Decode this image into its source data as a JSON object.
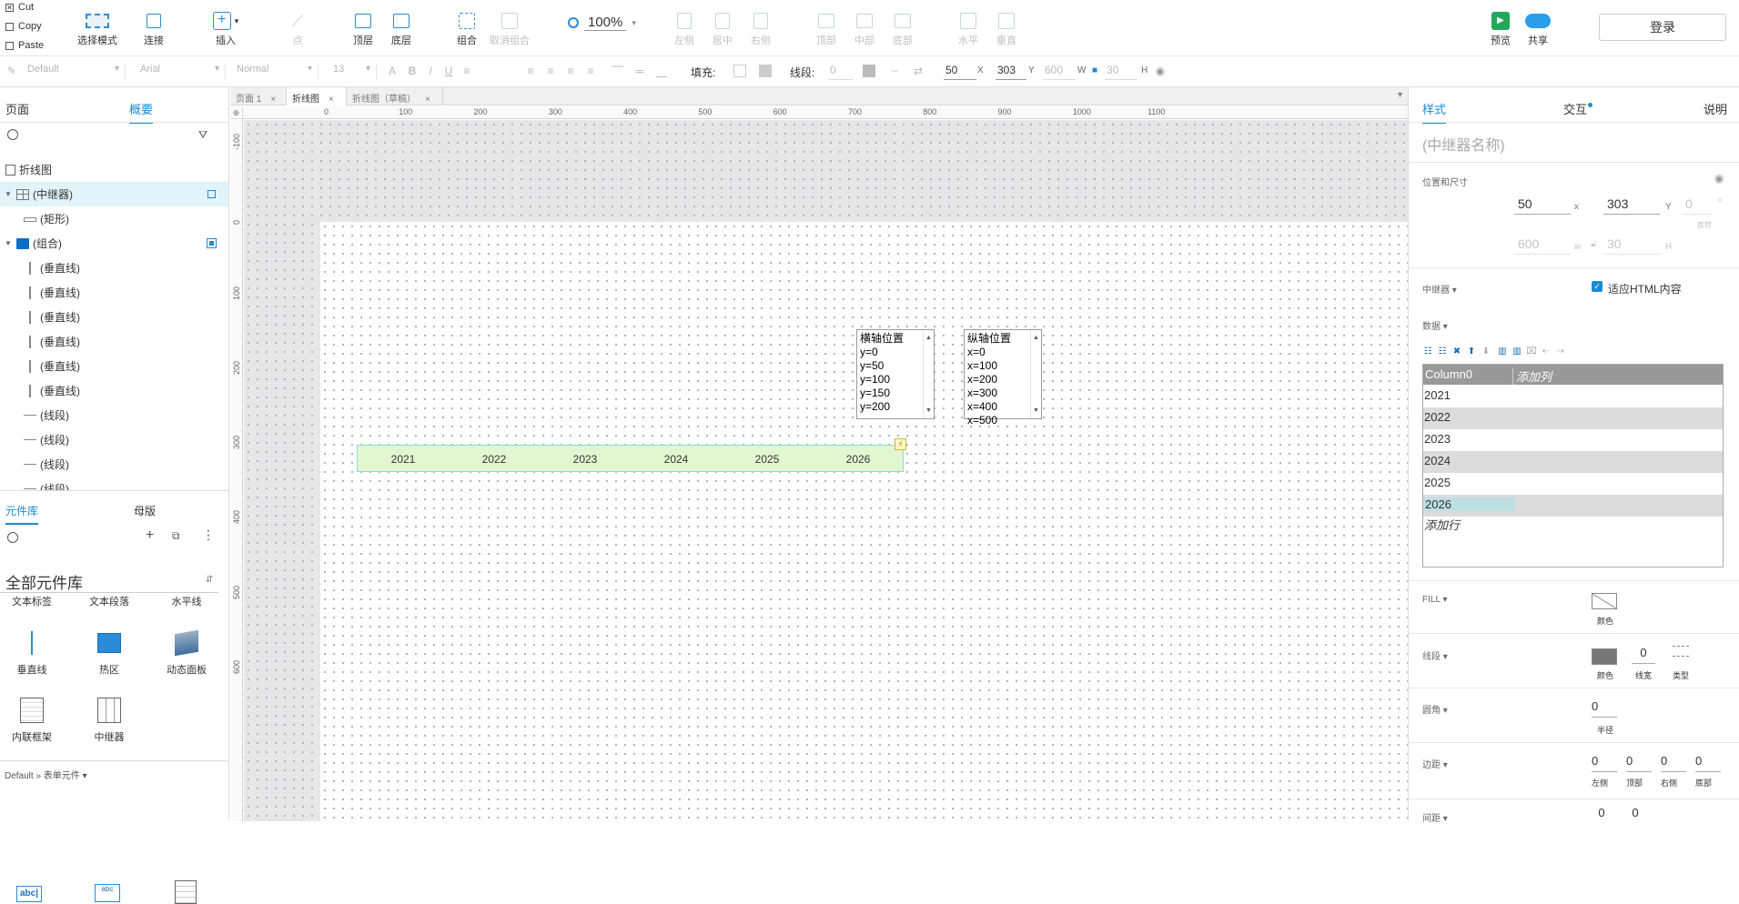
{
  "clipboard": {
    "cut": "Cut",
    "copy": "Copy",
    "paste": "Paste"
  },
  "toolbar": {
    "select_mode": "选择模式",
    "connect": "连接",
    "insert": "插入",
    "point": "点",
    "top_layer": "顶层",
    "bottom_layer": "底层",
    "group": "组合",
    "ungroup": "取消组合",
    "zoom": "100%",
    "align_left": "左侧",
    "align_center": "居中",
    "align_right": "右侧",
    "align_top": "顶部",
    "align_middle": "中部",
    "align_bottom": "底部",
    "dist_horizontal": "水平",
    "dist_vertical": "垂直",
    "preview": "预览",
    "share": "共享",
    "login": "登录"
  },
  "format_bar": {
    "style": "Default",
    "font": "Arial",
    "weight": "Normal",
    "size": "13",
    "fill_label": "填充:",
    "stroke_label": "线段:",
    "stroke_width": "0",
    "x": "50",
    "x_label": "X",
    "y": "303",
    "y_label": "Y",
    "w": "600",
    "w_label": "W",
    "h": "30",
    "h_label": "H"
  },
  "left_panel": {
    "tabs": [
      "页面",
      "概要"
    ],
    "active_tab": 1,
    "outline_title": "折线图",
    "outline": [
      {
        "label": "(中继器)",
        "type": "repeater",
        "indent": 0,
        "selected": true,
        "toggle": "▼"
      },
      {
        "label": "(矩形)",
        "type": "rect",
        "indent": 1
      },
      {
        "label": "(组合)",
        "type": "folder",
        "indent": 0,
        "toggle": "▼"
      },
      {
        "label": "(垂直线)",
        "type": "vline",
        "indent": 1
      },
      {
        "label": "(垂直线)",
        "type": "vline",
        "indent": 1
      },
      {
        "label": "(垂直线)",
        "type": "vline",
        "indent": 1
      },
      {
        "label": "(垂直线)",
        "type": "vline",
        "indent": 1
      },
      {
        "label": "(垂直线)",
        "type": "vline",
        "indent": 1
      },
      {
        "label": "(垂直线)",
        "type": "vline",
        "indent": 1
      },
      {
        "label": "(线段)",
        "type": "hline",
        "indent": 1
      },
      {
        "label": "(线段)",
        "type": "hline",
        "indent": 1
      },
      {
        "label": "(线段)",
        "type": "hline",
        "indent": 1
      },
      {
        "label": "(线段)",
        "type": "hline",
        "indent": 1
      }
    ],
    "lib_tabs": [
      "元件库",
      "母版"
    ],
    "lib_title": "全部元件库",
    "lib_items_top": [
      "文本标签",
      "文本段落",
      "水平线"
    ],
    "lib_items": [
      "垂直线",
      "热区",
      "动态面板",
      "内联框架",
      "中继器"
    ],
    "lib_footer": "Default » 表单元件 ▾",
    "lib_bottom_glyphs": [
      "abc|",
      "abc",
      ""
    ]
  },
  "canvas": {
    "tabs": [
      {
        "label": "页面 1"
      },
      {
        "label": "折线图",
        "active": true
      },
      {
        "label": "折线图（草稿）"
      }
    ],
    "h_ruler": [
      "0",
      "100",
      "200",
      "300",
      "400",
      "500",
      "600",
      "700",
      "800",
      "900",
      "1000",
      "1100"
    ],
    "v_ruler": [
      "-100",
      "0",
      "100",
      "200",
      "300",
      "400",
      "500",
      "600"
    ],
    "y_axis_box": {
      "title": "横轴位置",
      "items": [
        "y=0",
        "y=50",
        "y=100",
        "y=150",
        "y=200"
      ]
    },
    "x_axis_box": {
      "title": "纵轴位置",
      "items": [
        "x=0",
        "x=100",
        "x=200",
        "x=300",
        "x=400",
        "x=500"
      ]
    },
    "repeater_items": [
      "2021",
      "2022",
      "2023",
      "2024",
      "2025",
      "2026"
    ]
  },
  "right_panel": {
    "tabs": [
      "样式",
      "交互",
      "说明"
    ],
    "active_tab": 0,
    "name_placeholder": "(中继器名称)",
    "pos_size_label": "位置和尺寸",
    "x": "50",
    "x_label": "x",
    "y": "303",
    "y_label": "Y",
    "rot": "0",
    "rot_label": "旋转",
    "rot_unit": "°",
    "w": "600",
    "w_label": "w",
    "h": "30",
    "h_label": "H",
    "repeater_label": "中继器 ▾",
    "fit_html_label": "适应HTML内容",
    "data_label": "数据 ▾",
    "data_columns": [
      "Column0",
      "添加列"
    ],
    "data_rows": [
      "2021",
      "2022",
      "2023",
      "2024",
      "2025",
      "2026"
    ],
    "add_row": "添加行",
    "fill_label": "FILL ▾",
    "fill_color_label": "颜色",
    "stroke_label": "线段 ▾",
    "stroke_color_label": "颜色",
    "stroke_width": "0",
    "stroke_width_label": "线宽",
    "stroke_type_label": "类型",
    "corner_label": "圆角 ▾",
    "corner_value": "0",
    "corner_radius_label": "半径",
    "padding_label": "边距 ▾",
    "padding_values": [
      "0",
      "0",
      "0",
      "0"
    ],
    "padding_labels": [
      "左侧",
      "顶部",
      "右侧",
      "底部"
    ],
    "spacing_label": "间距 ▾",
    "spacing_values": [
      "0",
      "0"
    ]
  },
  "colors": {
    "accent": "#1b8ad3",
    "repeater_fill": "#e2f7d1",
    "repeater_border": "#8cd9d7"
  }
}
